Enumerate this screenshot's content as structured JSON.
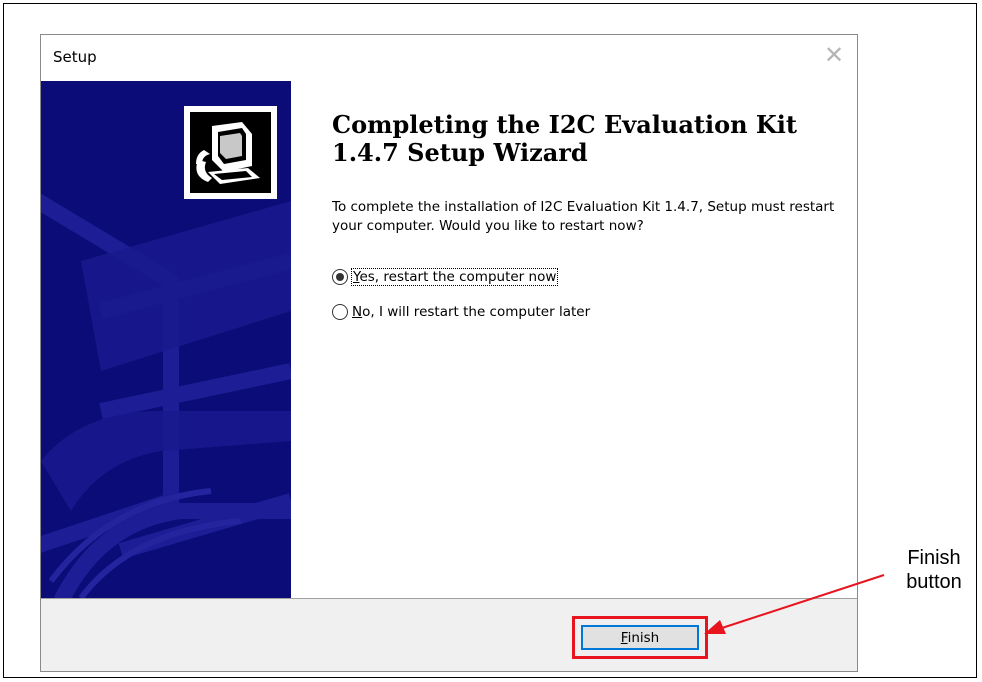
{
  "dialog": {
    "title": "Setup",
    "close_glyph": "✕",
    "heading": "Completing the I2C Evaluation Kit 1.4.7 Setup Wizard",
    "description": "To complete the installation of I2C Evaluation Kit 1.4.7, Setup must restart your computer. Would you like to restart now?",
    "options": [
      {
        "access_key": "Y",
        "label_rest": "es, restart the computer now",
        "selected": true
      },
      {
        "access_key": "N",
        "label_rest": "o, I will restart the computer later",
        "selected": false
      }
    ],
    "finish_button": {
      "access_key": "F",
      "label_rest": "inish"
    }
  },
  "annotation": {
    "label_line1": "Finish",
    "label_line2": "button",
    "highlight_color": "#e8141e"
  },
  "colors": {
    "side_panel": "#0c0c78",
    "button_focus_border": "#0078d7",
    "footer_bg": "#f0f0f0"
  },
  "icons": {
    "side_logo": "computer-install-icon",
    "close": "close-icon"
  }
}
